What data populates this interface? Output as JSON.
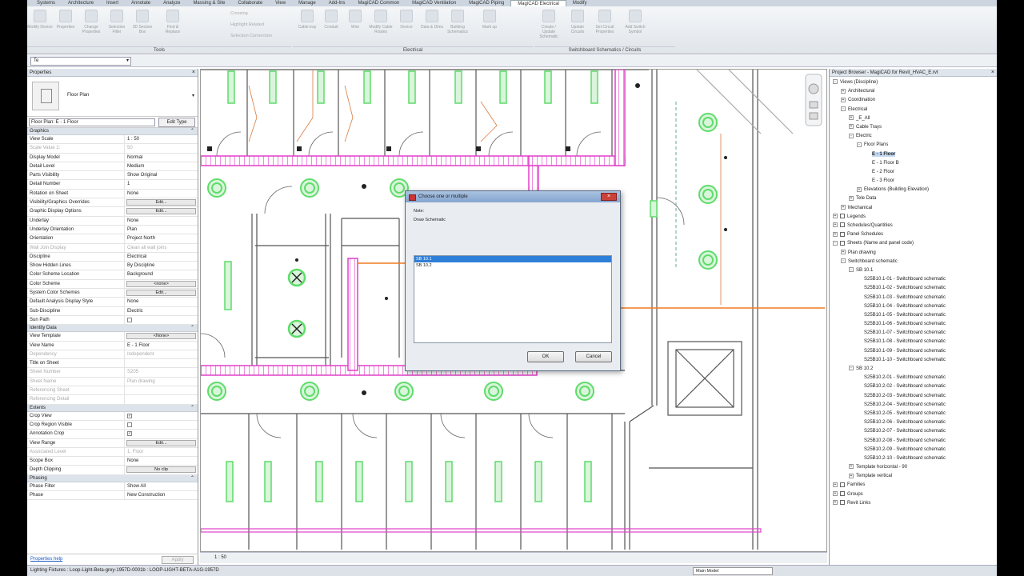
{
  "ribbon": {
    "tabs": [
      "Systems",
      "Architecture",
      "Insert",
      "Annotate",
      "Analyze",
      "Massing & Site",
      "Collaborate",
      "View",
      "Manage",
      "Add-Ins",
      "MagiCAD Common",
      "MagiCAD Ventilation",
      "MagiCAD Piping",
      "MagiCAD Electrical",
      "Modify"
    ],
    "active_tab": "MagiCAD Electrical",
    "groups": [
      "Tools",
      "Electrical",
      "Switchboard Schematics / Circuits"
    ],
    "buttons": [
      "Modify Device",
      "Properties",
      "Change Properties",
      "Selection Filter",
      "3D Section Box",
      "Find & Replace",
      "Cable tray",
      "Conduit",
      "Wire",
      "Modify Cable Routes",
      "Device",
      "Data & Dims",
      "Building Schematics",
      "Mark up",
      "Create / Update Schematic",
      "Update Circuits",
      "Set Circuit Properties",
      "Add Switch Symbol"
    ],
    "small": [
      "Crossing",
      "Highlight Related",
      "Selection Connection"
    ]
  },
  "optbar": {
    "modify_value": "Te"
  },
  "properties": {
    "title": "Properties",
    "type_name": "Floor Plan",
    "filter": "Floor Plan: E - 1 Floor",
    "edit_type": "Edit Type",
    "groups": [
      {
        "name": "Graphics",
        "rows": [
          {
            "k": "View Scale",
            "v": "1 : 50"
          },
          {
            "k": "Scale Value    1:",
            "v": "50",
            "dim": true
          },
          {
            "k": "Display Model",
            "v": "Normal"
          },
          {
            "k": "Detail Level",
            "v": "Medium"
          },
          {
            "k": "Parts Visibility",
            "v": "Show Original"
          },
          {
            "k": "Detail Number",
            "v": "1"
          },
          {
            "k": "Rotation on Sheet",
            "v": "None"
          },
          {
            "k": "Visibility/Graphics Overrides",
            "v": "Edit...",
            "btn": true
          },
          {
            "k": "Graphic Display Options",
            "v": "Edit...",
            "btn": true
          },
          {
            "k": "Underlay",
            "v": "None"
          },
          {
            "k": "Underlay Orientation",
            "v": "Plan"
          },
          {
            "k": "Orientation",
            "v": "Project North"
          },
          {
            "k": "Wall Join Display",
            "v": "Clean all wall joins",
            "dim": true
          },
          {
            "k": "Discipline",
            "v": "Electrical"
          },
          {
            "k": "Show Hidden Lines",
            "v": "By Discipline"
          },
          {
            "k": "Color Scheme Location",
            "v": "Background"
          },
          {
            "k": "Color Scheme",
            "v": "<none>",
            "btn": true
          },
          {
            "k": "System Color Schemes",
            "v": "Edit...",
            "btn": true
          },
          {
            "k": "Default Analysis Display Style",
            "v": "None"
          },
          {
            "k": "Sub-Discipline",
            "v": "Electric"
          },
          {
            "k": "Sun Path",
            "v": "",
            "check": false
          }
        ]
      },
      {
        "name": "Identity Data",
        "rows": [
          {
            "k": "View Template",
            "v": "<None>",
            "btn": true
          },
          {
            "k": "View Name",
            "v": "E - 1 Floor"
          },
          {
            "k": "Dependency",
            "v": "Independent",
            "dim": true
          },
          {
            "k": "Title on Sheet",
            "v": ""
          },
          {
            "k": "Sheet Number",
            "v": "S205",
            "dim": true
          },
          {
            "k": "Sheet Name",
            "v": "Plan drawing",
            "dim": true
          },
          {
            "k": "Referencing Sheet",
            "v": "",
            "dim": true
          },
          {
            "k": "Referencing Detail",
            "v": "",
            "dim": true
          }
        ]
      },
      {
        "name": "Extents",
        "rows": [
          {
            "k": "Crop View",
            "v": "",
            "check": true
          },
          {
            "k": "Crop Region Visible",
            "v": "",
            "check": false
          },
          {
            "k": "Annotation Crop",
            "v": "",
            "check": true
          },
          {
            "k": "View Range",
            "v": "Edit...",
            "btn": true
          },
          {
            "k": "Associated Level",
            "v": "1. Floor",
            "dim": true
          },
          {
            "k": "Scope Box",
            "v": "None"
          },
          {
            "k": "Depth Clipping",
            "v": "No clip",
            "btn": true
          }
        ]
      },
      {
        "name": "Phasing",
        "rows": [
          {
            "k": "Phase Filter",
            "v": "Show All"
          },
          {
            "k": "Phase",
            "v": "New Construction"
          }
        ]
      }
    ],
    "help_link": "Properties help",
    "apply": "Apply"
  },
  "dialog": {
    "title": "Choose one or multiple",
    "note": "Note:",
    "text": "Draw Schematic",
    "items": [
      "SB 10.1",
      "SB 10.2"
    ],
    "selected": 0,
    "ok": "OK",
    "cancel": "Cancel"
  },
  "viewbar": {
    "scale": "1 : 50"
  },
  "browser": {
    "title": "Project Browser - MagiCAD for Revit_HVAC_E.rvt",
    "nodes": [
      {
        "l": 0,
        "t": "Views (Discipline)",
        "e": "-"
      },
      {
        "l": 1,
        "t": "Architectural",
        "e": "+"
      },
      {
        "l": 1,
        "t": "Coordination",
        "e": "+"
      },
      {
        "l": 1,
        "t": "Electrical",
        "e": "-"
      },
      {
        "l": 2,
        "t": "_E_All",
        "e": "+"
      },
      {
        "l": 2,
        "t": "Cable Trays",
        "e": "+"
      },
      {
        "l": 2,
        "t": "Electric",
        "e": "-"
      },
      {
        "l": 3,
        "t": "Floor Plans",
        "e": "-"
      },
      {
        "l": 4,
        "t": "E - 1 Floor",
        "hl": true
      },
      {
        "l": 4,
        "t": "E - 1 Floor B"
      },
      {
        "l": 4,
        "t": "E - 2 Floor"
      },
      {
        "l": 4,
        "t": "E - 3 Floor"
      },
      {
        "l": 3,
        "t": "Elevations (Building Elevation)",
        "e": "+"
      },
      {
        "l": 2,
        "t": "Tele Data",
        "e": "+"
      },
      {
        "l": 1,
        "t": "Mechanical",
        "e": "+"
      },
      {
        "l": 0,
        "t": "Legends",
        "e": "+",
        "icon": true
      },
      {
        "l": 0,
        "t": "Schedules/Quantities",
        "e": "+",
        "icon": true
      },
      {
        "l": 0,
        "t": "Panel Schedules",
        "e": "+",
        "icon": true
      },
      {
        "l": 0,
        "t": "Sheets (Name and panel code)",
        "e": "-",
        "icon": true
      },
      {
        "l": 1,
        "t": "Plan drawing",
        "e": "+"
      },
      {
        "l": 1,
        "t": "Switchboard schematic",
        "e": "-"
      },
      {
        "l": 2,
        "t": "SB 10.1",
        "e": "-"
      },
      {
        "l": 3,
        "t": "S25B10.1-01 - Switchboard schematic"
      },
      {
        "l": 3,
        "t": "S25B10.1-02 - Switchboard schematic"
      },
      {
        "l": 3,
        "t": "S25B10.1-03 - Switchboard schematic"
      },
      {
        "l": 3,
        "t": "S25B10.1-04 - Switchboard schematic"
      },
      {
        "l": 3,
        "t": "S25B10.1-05 - Switchboard schematic"
      },
      {
        "l": 3,
        "t": "S25B10.1-06 - Switchboard schematic"
      },
      {
        "l": 3,
        "t": "S25B10.1-07 - Switchboard schematic"
      },
      {
        "l": 3,
        "t": "S25B10.1-08 - Switchboard schematic"
      },
      {
        "l": 3,
        "t": "S25B10.1-09 - Switchboard schematic"
      },
      {
        "l": 3,
        "t": "S25B10.1-10 - Switchboard schematic"
      },
      {
        "l": 2,
        "t": "SB 10.2",
        "e": "-"
      },
      {
        "l": 3,
        "t": "S25B10.2-01 - Switchboard schematic"
      },
      {
        "l": 3,
        "t": "S25B10.2-02 - Switchboard schematic"
      },
      {
        "l": 3,
        "t": "S25B10.2-03 - Switchboard schematic"
      },
      {
        "l": 3,
        "t": "S25B10.2-04 - Switchboard schematic"
      },
      {
        "l": 3,
        "t": "S25B10.2-05 - Switchboard schematic"
      },
      {
        "l": 3,
        "t": "S25B10.2-06 - Switchboard schematic"
      },
      {
        "l": 3,
        "t": "S25B10.2-07 - Switchboard schematic"
      },
      {
        "l": 3,
        "t": "S25B10.2-08 - Switchboard schematic"
      },
      {
        "l": 3,
        "t": "S25B10.2-09 - Switchboard schematic"
      },
      {
        "l": 3,
        "t": "S25B10.2-10 - Switchboard schematic"
      },
      {
        "l": 2,
        "t": "Template horizontal - 90",
        "e": "+"
      },
      {
        "l": 2,
        "t": "Template vertical",
        "e": "+"
      },
      {
        "l": 0,
        "t": "Families",
        "e": "+",
        "icon": true
      },
      {
        "l": 0,
        "t": "Groups",
        "e": "+",
        "icon": true
      },
      {
        "l": 0,
        "t": "Revit Links",
        "e": "+",
        "icon": true
      }
    ]
  },
  "status": {
    "text": "Lighting Fixtures : Loop-Light-Beta-grey-1957D-0001b : LOOP-LIGHT-BETA-A1G-1957D",
    "model": "Main Model"
  },
  "colors": {
    "tray": "#e040c8",
    "fixture": "#5fdc6a",
    "cable": "#f07a20",
    "accent": "#2f7fd8"
  }
}
